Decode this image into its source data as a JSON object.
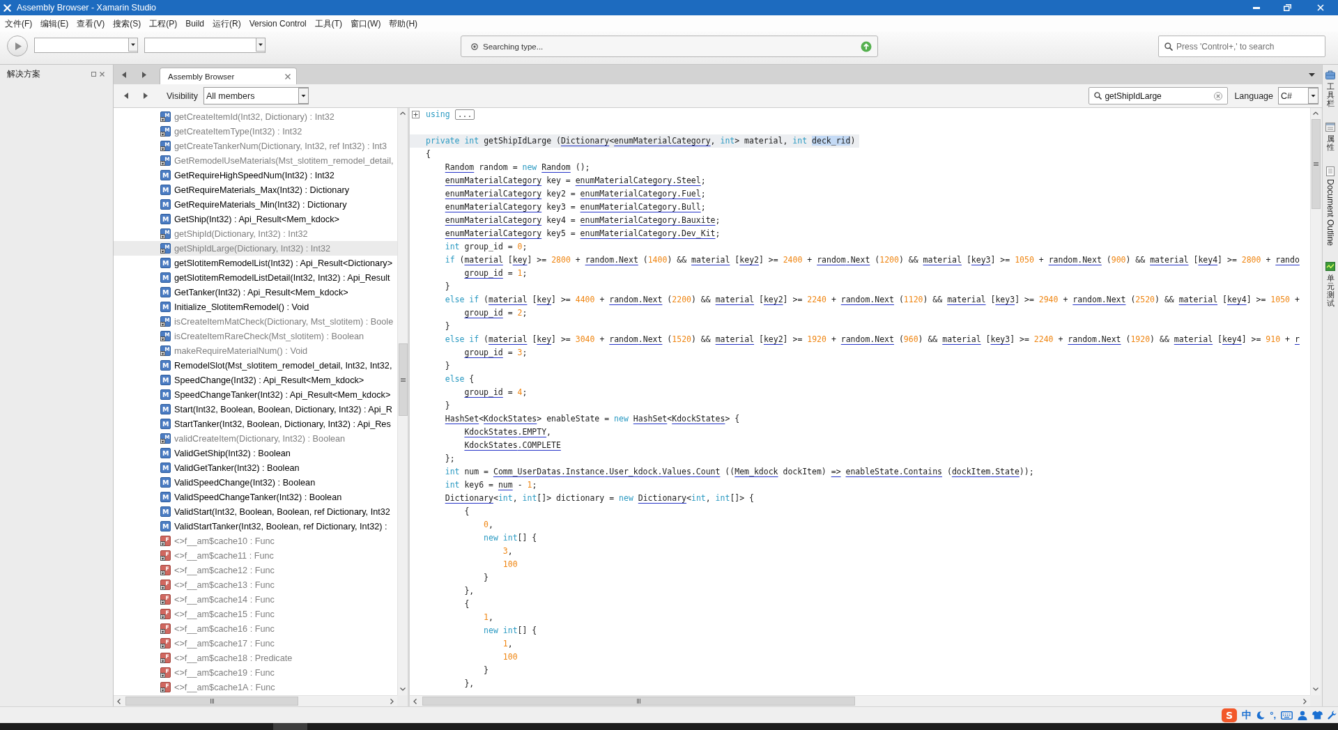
{
  "window": {
    "title": "Assembly Browser - Xamarin Studio"
  },
  "menu": [
    "文件(F)",
    "编辑(E)",
    "查看(V)",
    "搜索(S)",
    "工程(P)",
    "Build",
    "运行(R)",
    "Version Control",
    "工具(T)",
    "窗口(W)",
    "帮助(H)"
  ],
  "toolbar": {
    "status": "Searching type...",
    "search": {
      "placeholder": "Press 'Control+,' to search"
    }
  },
  "solution_pad": {
    "title": "解决方案"
  },
  "tabs": [
    {
      "label": "Assembly Browser",
      "selected": true
    }
  ],
  "browser_toolbar": {
    "visibility_label": "Visibility",
    "visibility": "All members",
    "search": {
      "value": "getShipIdLarge"
    },
    "language_label": "Language",
    "language": "C#"
  },
  "members": [
    {
      "badge": "M",
      "kind": "method",
      "label": "getCreateItemId(Int32, Dictionary) : Int32",
      "private": true,
      "selected": false
    },
    {
      "badge": "M",
      "kind": "method",
      "label": "getCreateItemType(Int32) : Int32",
      "private": true,
      "selected": false
    },
    {
      "badge": "M",
      "kind": "method",
      "label": "getCreateTankerNum(Dictionary, Int32, ref Int32) : Int3",
      "private": true,
      "selected": false
    },
    {
      "badge": "M",
      "kind": "method",
      "label": "GetRemodelUseMaterials(Mst_slotitem_remodel_detail,",
      "private": true,
      "selected": false
    },
    {
      "badge": "M",
      "kind": "method",
      "label": "GetRequireHighSpeedNum(Int32) : Int32",
      "private": false,
      "selected": false
    },
    {
      "badge": "M",
      "kind": "method",
      "label": "GetRequireMaterials_Max(Int32) : Dictionary",
      "private": false,
      "selected": false
    },
    {
      "badge": "M",
      "kind": "method",
      "label": "GetRequireMaterials_Min(Int32) : Dictionary",
      "private": false,
      "selected": false
    },
    {
      "badge": "M",
      "kind": "method",
      "label": "GetShip(Int32) : Api_Result<Mem_kdock>",
      "private": false,
      "selected": false
    },
    {
      "badge": "M",
      "kind": "method",
      "label": "getShipId(Dictionary, Int32) : Int32",
      "private": true,
      "selected": false
    },
    {
      "badge": "M",
      "kind": "method",
      "label": "getShipIdLarge(Dictionary, Int32) : Int32",
      "private": true,
      "selected": true
    },
    {
      "badge": "M",
      "kind": "method",
      "label": "getSlotitemRemodelList(Int32) : Api_Result<Dictionary>",
      "private": false,
      "selected": false
    },
    {
      "badge": "M",
      "kind": "method",
      "label": "getSlotitemRemodelListDetail(Int32, Int32) : Api_Result",
      "private": false,
      "selected": false
    },
    {
      "badge": "M",
      "kind": "method",
      "label": "GetTanker(Int32) : Api_Result<Mem_kdock>",
      "private": false,
      "selected": false
    },
    {
      "badge": "M",
      "kind": "method",
      "label": "Initialize_SlotitemRemodel() : Void",
      "private": false,
      "selected": false
    },
    {
      "badge": "M",
      "kind": "method",
      "label": "isCreateItemMatCheck(Dictionary, Mst_slotitem) : Boole",
      "private": true,
      "selected": false
    },
    {
      "badge": "M",
      "kind": "method",
      "label": "isCreateItemRareCheck(Mst_slotitem) : Boolean",
      "private": true,
      "selected": false
    },
    {
      "badge": "M",
      "kind": "method",
      "label": "makeRequireMaterialNum() : Void",
      "private": true,
      "selected": false
    },
    {
      "badge": "M",
      "kind": "method",
      "label": "RemodelSlot(Mst_slotitem_remodel_detail, Int32, Int32,",
      "private": false,
      "selected": false
    },
    {
      "badge": "M",
      "kind": "method",
      "label": "SpeedChange(Int32) : Api_Result<Mem_kdock>",
      "private": false,
      "selected": false
    },
    {
      "badge": "M",
      "kind": "method",
      "label": "SpeedChangeTanker(Int32) : Api_Result<Mem_kdock>",
      "private": false,
      "selected": false
    },
    {
      "badge": "M",
      "kind": "method",
      "label": "Start(Int32, Boolean, Boolean, Dictionary, Int32) : Api_R",
      "private": false,
      "selected": false
    },
    {
      "badge": "M",
      "kind": "method",
      "label": "StartTanker(Int32, Boolean, Dictionary, Int32) : Api_Res",
      "private": false,
      "selected": false
    },
    {
      "badge": "M",
      "kind": "method",
      "label": "validCreateItem(Dictionary, Int32) : Boolean",
      "private": true,
      "selected": false
    },
    {
      "badge": "M",
      "kind": "method",
      "label": "ValidGetShip(Int32) : Boolean",
      "private": false,
      "selected": false
    },
    {
      "badge": "M",
      "kind": "method",
      "label": "ValidGetTanker(Int32) : Boolean",
      "private": false,
      "selected": false
    },
    {
      "badge": "M",
      "kind": "method",
      "label": "ValidSpeedChange(Int32) : Boolean",
      "private": false,
      "selected": false
    },
    {
      "badge": "M",
      "kind": "method",
      "label": "ValidSpeedChangeTanker(Int32) : Boolean",
      "private": false,
      "selected": false
    },
    {
      "badge": "M",
      "kind": "method",
      "label": "ValidStart(Int32, Boolean, Boolean, ref Dictionary, Int32",
      "private": false,
      "selected": false
    },
    {
      "badge": "M",
      "kind": "method",
      "label": "ValidStartTanker(Int32, Boolean, ref Dictionary, Int32) :",
      "private": false,
      "selected": false
    },
    {
      "badge": "F",
      "kind": "field",
      "label": "<>f__am$cache10 : Func",
      "private": true,
      "selected": false
    },
    {
      "badge": "F",
      "kind": "field",
      "label": "<>f__am$cache11 : Func",
      "private": true,
      "selected": false
    },
    {
      "badge": "F",
      "kind": "field",
      "label": "<>f__am$cache12 : Func",
      "private": true,
      "selected": false
    },
    {
      "badge": "F",
      "kind": "field",
      "label": "<>f__am$cache13 : Func",
      "private": true,
      "selected": false
    },
    {
      "badge": "F",
      "kind": "field",
      "label": "<>f__am$cache14 : Func",
      "private": true,
      "selected": false
    },
    {
      "badge": "F",
      "kind": "field",
      "label": "<>f__am$cache15 : Func",
      "private": true,
      "selected": false
    },
    {
      "badge": "F",
      "kind": "field",
      "label": "<>f__am$cache16 : Func",
      "private": true,
      "selected": false
    },
    {
      "badge": "F",
      "kind": "field",
      "label": "<>f__am$cache17 : Func",
      "private": true,
      "selected": false
    },
    {
      "badge": "F",
      "kind": "field",
      "label": "<>f__am$cache18 : Predicate",
      "private": true,
      "selected": false
    },
    {
      "badge": "F",
      "kind": "field",
      "label": "<>f__am$cache19 : Func",
      "private": true,
      "selected": false
    },
    {
      "badge": "F",
      "kind": "field",
      "label": "<>f__am$cache1A : Func",
      "private": true,
      "selected": false
    }
  ],
  "code": {
    "using": {
      "keyword": "using",
      "label": "...",
      "expanded": false
    },
    "signature": [
      {
        "text": "private ",
        "kind": "keyword"
      },
      {
        "text": "int",
        "kind": "keyword"
      },
      {
        "text": " getShipIdLarge (",
        "kind": "plain"
      },
      {
        "text": "Dictionary",
        "kind": "reference"
      },
      {
        "text": "<",
        "kind": "plain"
      },
      {
        "text": "enumMaterialCategory",
        "kind": "reference"
      },
      {
        "text": ", ",
        "kind": "plain"
      },
      {
        "text": "int",
        "kind": "keyword"
      },
      {
        "text": "> material, ",
        "kind": "plain"
      },
      {
        "text": "int ",
        "kind": "keyword"
      },
      {
        "text": "deck_rid",
        "kind": "selection"
      },
      {
        "text": ")",
        "kind": "plain"
      }
    ],
    "lines": [
      {
        "tokens": [
          {
            "text": "{",
            "kind": "plain"
          }
        ]
      },
      {
        "tokens": [
          {
            "text": "    Random",
            "kind": "reference"
          },
          {
            "text": " random = ",
            "kind": "plain"
          },
          {
            "text": "new ",
            "kind": "keyword"
          },
          {
            "text": "Random",
            "kind": "reference"
          },
          {
            "text": " ();",
            "kind": "plain"
          }
        ]
      },
      {
        "tokens": [
          {
            "text": "    enumMaterialCategory",
            "kind": "reference"
          },
          {
            "text": " key = ",
            "kind": "plain"
          },
          {
            "text": "enumMaterialCategory",
            "kind": "reference"
          },
          {
            "text": ".Steel",
            "kind": "reference"
          },
          {
            "text": ";",
            "kind": "plain"
          }
        ]
      },
      {
        "tokens": [
          {
            "text": "    enumMaterialCategory",
            "kind": "reference"
          },
          {
            "text": " key2 = ",
            "kind": "plain"
          },
          {
            "text": "enumMaterialCategory",
            "kind": "reference"
          },
          {
            "text": ".Fuel",
            "kind": "reference"
          },
          {
            "text": ";",
            "kind": "plain"
          }
        ]
      },
      {
        "tokens": [
          {
            "text": "    enumMaterialCategory",
            "kind": "reference"
          },
          {
            "text": " key3 = ",
            "kind": "plain"
          },
          {
            "text": "enumMaterialCategory",
            "kind": "reference"
          },
          {
            "text": ".Bull",
            "kind": "reference"
          },
          {
            "text": ";",
            "kind": "plain"
          }
        ]
      },
      {
        "tokens": [
          {
            "text": "    enumMaterialCategory",
            "kind": "reference"
          },
          {
            "text": " key4 = ",
            "kind": "plain"
          },
          {
            "text": "enumMaterialCategory",
            "kind": "reference"
          },
          {
            "text": ".Bauxite",
            "kind": "reference"
          },
          {
            "text": ";",
            "kind": "plain"
          }
        ]
      },
      {
        "tokens": [
          {
            "text": "    enumMaterialCategory",
            "kind": "reference"
          },
          {
            "text": " key5 = ",
            "kind": "plain"
          },
          {
            "text": "enumMaterialCategory",
            "kind": "reference"
          },
          {
            "text": ".Dev_Kit",
            "kind": "reference"
          },
          {
            "text": ";",
            "kind": "plain"
          }
        ]
      },
      {
        "tokens": [
          {
            "text": "    int",
            "kind": "keyword"
          },
          {
            "text": " group_id = ",
            "kind": "plain"
          },
          {
            "text": "0",
            "kind": "number"
          },
          {
            "text": ";",
            "kind": "plain"
          }
        ]
      },
      {
        "tokens": [
          {
            "text": "    if",
            "kind": "keyword"
          },
          {
            "text": " (",
            "kind": "plain"
          },
          {
            "text": "material",
            "kind": "reference"
          },
          {
            "text": " [",
            "kind": "plain"
          },
          {
            "text": "key",
            "kind": "reference"
          },
          {
            "text": "] >= ",
            "kind": "plain"
          },
          {
            "text": "2800",
            "kind": "number"
          },
          {
            "text": " + ",
            "kind": "plain"
          },
          {
            "text": "random",
            "kind": "reference"
          },
          {
            "text": ".Next",
            "kind": "reference"
          },
          {
            "text": " (",
            "kind": "plain"
          },
          {
            "text": "1400",
            "kind": "number"
          },
          {
            "text": ") && ",
            "kind": "plain"
          },
          {
            "text": "material",
            "kind": "reference"
          },
          {
            "text": " [",
            "kind": "plain"
          },
          {
            "text": "key2",
            "kind": "reference"
          },
          {
            "text": "] >= ",
            "kind": "plain"
          },
          {
            "text": "2400",
            "kind": "number"
          },
          {
            "text": " + ",
            "kind": "plain"
          },
          {
            "text": "random",
            "kind": "reference"
          },
          {
            "text": ".Next",
            "kind": "reference"
          },
          {
            "text": " (",
            "kind": "plain"
          },
          {
            "text": "1200",
            "kind": "number"
          },
          {
            "text": ") && ",
            "kind": "plain"
          },
          {
            "text": "material",
            "kind": "reference"
          },
          {
            "text": " [",
            "kind": "plain"
          },
          {
            "text": "key3",
            "kind": "reference"
          },
          {
            "text": "] >= ",
            "kind": "plain"
          },
          {
            "text": "1050",
            "kind": "number"
          },
          {
            "text": " + ",
            "kind": "plain"
          },
          {
            "text": "random",
            "kind": "reference"
          },
          {
            "text": ".Next",
            "kind": "reference"
          },
          {
            "text": " (",
            "kind": "plain"
          },
          {
            "text": "900",
            "kind": "number"
          },
          {
            "text": ") && ",
            "kind": "plain"
          },
          {
            "text": "material",
            "kind": "reference"
          },
          {
            "text": " [",
            "kind": "plain"
          },
          {
            "text": "key4",
            "kind": "reference"
          },
          {
            "text": "] >= ",
            "kind": "plain"
          },
          {
            "text": "2800",
            "kind": "number"
          },
          {
            "text": " + ",
            "kind": "plain"
          },
          {
            "text": "rando",
            "kind": "reference"
          }
        ]
      },
      {
        "tokens": [
          {
            "text": "        group_id",
            "kind": "reference"
          },
          {
            "text": " = ",
            "kind": "plain"
          },
          {
            "text": "1",
            "kind": "number"
          },
          {
            "text": ";",
            "kind": "plain"
          }
        ]
      },
      {
        "tokens": [
          {
            "text": "    }",
            "kind": "plain"
          }
        ]
      },
      {
        "tokens": [
          {
            "text": "    else if",
            "kind": "keyword"
          },
          {
            "text": " (",
            "kind": "plain"
          },
          {
            "text": "material",
            "kind": "reference"
          },
          {
            "text": " [",
            "kind": "plain"
          },
          {
            "text": "key",
            "kind": "reference"
          },
          {
            "text": "] >= ",
            "kind": "plain"
          },
          {
            "text": "4400",
            "kind": "number"
          },
          {
            "text": " + ",
            "kind": "plain"
          },
          {
            "text": "random",
            "kind": "reference"
          },
          {
            "text": ".Next",
            "kind": "reference"
          },
          {
            "text": " (",
            "kind": "plain"
          },
          {
            "text": "2200",
            "kind": "number"
          },
          {
            "text": ") && ",
            "kind": "plain"
          },
          {
            "text": "material",
            "kind": "reference"
          },
          {
            "text": " [",
            "kind": "plain"
          },
          {
            "text": "key2",
            "kind": "reference"
          },
          {
            "text": "] >= ",
            "kind": "plain"
          },
          {
            "text": "2240",
            "kind": "number"
          },
          {
            "text": " + ",
            "kind": "plain"
          },
          {
            "text": "random",
            "kind": "reference"
          },
          {
            "text": ".Next",
            "kind": "reference"
          },
          {
            "text": " (",
            "kind": "plain"
          },
          {
            "text": "1120",
            "kind": "number"
          },
          {
            "text": ") && ",
            "kind": "plain"
          },
          {
            "text": "material",
            "kind": "reference"
          },
          {
            "text": " [",
            "kind": "plain"
          },
          {
            "text": "key3",
            "kind": "reference"
          },
          {
            "text": "] >= ",
            "kind": "plain"
          },
          {
            "text": "2940",
            "kind": "number"
          },
          {
            "text": " + ",
            "kind": "plain"
          },
          {
            "text": "random",
            "kind": "reference"
          },
          {
            "text": ".Next",
            "kind": "reference"
          },
          {
            "text": " (",
            "kind": "plain"
          },
          {
            "text": "2520",
            "kind": "number"
          },
          {
            "text": ") && ",
            "kind": "plain"
          },
          {
            "text": "material",
            "kind": "reference"
          },
          {
            "text": " [",
            "kind": "plain"
          },
          {
            "text": "key4",
            "kind": "reference"
          },
          {
            "text": "] >= ",
            "kind": "plain"
          },
          {
            "text": "1050",
            "kind": "number"
          },
          {
            "text": " +",
            "kind": "plain"
          }
        ]
      },
      {
        "tokens": [
          {
            "text": "        group_id",
            "kind": "reference"
          },
          {
            "text": " = ",
            "kind": "plain"
          },
          {
            "text": "2",
            "kind": "number"
          },
          {
            "text": ";",
            "kind": "plain"
          }
        ]
      },
      {
        "tokens": [
          {
            "text": "    }",
            "kind": "plain"
          }
        ]
      },
      {
        "tokens": [
          {
            "text": "    else if",
            "kind": "keyword"
          },
          {
            "text": " (",
            "kind": "plain"
          },
          {
            "text": "material",
            "kind": "reference"
          },
          {
            "text": " [",
            "kind": "plain"
          },
          {
            "text": "key",
            "kind": "reference"
          },
          {
            "text": "] >= ",
            "kind": "plain"
          },
          {
            "text": "3040",
            "kind": "number"
          },
          {
            "text": " + ",
            "kind": "plain"
          },
          {
            "text": "random",
            "kind": "reference"
          },
          {
            "text": ".Next",
            "kind": "reference"
          },
          {
            "text": " (",
            "kind": "plain"
          },
          {
            "text": "1520",
            "kind": "number"
          },
          {
            "text": ") && ",
            "kind": "plain"
          },
          {
            "text": "material",
            "kind": "reference"
          },
          {
            "text": " [",
            "kind": "plain"
          },
          {
            "text": "key2",
            "kind": "reference"
          },
          {
            "text": "] >= ",
            "kind": "plain"
          },
          {
            "text": "1920",
            "kind": "number"
          },
          {
            "text": " + ",
            "kind": "plain"
          },
          {
            "text": "random",
            "kind": "reference"
          },
          {
            "text": ".Next",
            "kind": "reference"
          },
          {
            "text": " (",
            "kind": "plain"
          },
          {
            "text": "960",
            "kind": "number"
          },
          {
            "text": ") && ",
            "kind": "plain"
          },
          {
            "text": "material",
            "kind": "reference"
          },
          {
            "text": " [",
            "kind": "plain"
          },
          {
            "text": "key3",
            "kind": "reference"
          },
          {
            "text": "] >= ",
            "kind": "plain"
          },
          {
            "text": "2240",
            "kind": "number"
          },
          {
            "text": " + ",
            "kind": "plain"
          },
          {
            "text": "random",
            "kind": "reference"
          },
          {
            "text": ".Next",
            "kind": "reference"
          },
          {
            "text": " (",
            "kind": "plain"
          },
          {
            "text": "1920",
            "kind": "number"
          },
          {
            "text": ") && ",
            "kind": "plain"
          },
          {
            "text": "material",
            "kind": "reference"
          },
          {
            "text": " [",
            "kind": "plain"
          },
          {
            "text": "key4",
            "kind": "reference"
          },
          {
            "text": "] >= ",
            "kind": "plain"
          },
          {
            "text": "910",
            "kind": "number"
          },
          {
            "text": " + ",
            "kind": "plain"
          },
          {
            "text": "r",
            "kind": "reference"
          }
        ]
      },
      {
        "tokens": [
          {
            "text": "        group_id",
            "kind": "reference"
          },
          {
            "text": " = ",
            "kind": "plain"
          },
          {
            "text": "3",
            "kind": "number"
          },
          {
            "text": ";",
            "kind": "plain"
          }
        ]
      },
      {
        "tokens": [
          {
            "text": "    }",
            "kind": "plain"
          }
        ]
      },
      {
        "tokens": [
          {
            "text": "    else",
            "kind": "keyword"
          },
          {
            "text": " {",
            "kind": "plain"
          }
        ]
      },
      {
        "tokens": [
          {
            "text": "        group_id",
            "kind": "reference"
          },
          {
            "text": " = ",
            "kind": "plain"
          },
          {
            "text": "4",
            "kind": "number"
          },
          {
            "text": ";",
            "kind": "plain"
          }
        ]
      },
      {
        "tokens": [
          {
            "text": "    }",
            "kind": "plain"
          }
        ]
      },
      {
        "tokens": [
          {
            "text": "    HashSet",
            "kind": "reference"
          },
          {
            "text": "<",
            "kind": "plain"
          },
          {
            "text": "KdockStates",
            "kind": "reference"
          },
          {
            "text": "> enableState = ",
            "kind": "plain"
          },
          {
            "text": "new ",
            "kind": "keyword"
          },
          {
            "text": "HashSet",
            "kind": "reference"
          },
          {
            "text": "<",
            "kind": "plain"
          },
          {
            "text": "KdockStates",
            "kind": "reference"
          },
          {
            "text": "> {",
            "kind": "plain"
          }
        ]
      },
      {
        "tokens": [
          {
            "text": "        KdockStates",
            "kind": "reference"
          },
          {
            "text": ".EMPTY",
            "kind": "reference"
          },
          {
            "text": ",",
            "kind": "plain"
          }
        ]
      },
      {
        "tokens": [
          {
            "text": "        KdockStates",
            "kind": "reference"
          },
          {
            "text": ".COMPLETE",
            "kind": "reference"
          }
        ]
      },
      {
        "tokens": [
          {
            "text": "    };",
            "kind": "plain"
          }
        ]
      },
      {
        "tokens": [
          {
            "text": "    int",
            "kind": "keyword"
          },
          {
            "text": " num = ",
            "kind": "plain"
          },
          {
            "text": "Comm_UserDatas",
            "kind": "reference"
          },
          {
            "text": ".Instance",
            "kind": "reference"
          },
          {
            "text": ".User_kdock",
            "kind": "reference"
          },
          {
            "text": ".Values",
            "kind": "reference"
          },
          {
            "text": ".Count",
            "kind": "reference"
          },
          {
            "text": " ((",
            "kind": "plain"
          },
          {
            "text": "Mem_kdock",
            "kind": "reference"
          },
          {
            "text": " dockItem) ",
            "kind": "plain"
          },
          {
            "text": "=> ",
            "kind": "reference"
          },
          {
            "text": "enableState",
            "kind": "reference"
          },
          {
            "text": ".Contains",
            "kind": "reference"
          },
          {
            "text": " (",
            "kind": "plain"
          },
          {
            "text": "dockItem",
            "kind": "reference"
          },
          {
            "text": ".State",
            "kind": "reference"
          },
          {
            "text": "));",
            "kind": "plain"
          }
        ]
      },
      {
        "tokens": [
          {
            "text": "    int",
            "kind": "keyword"
          },
          {
            "text": " key6 = ",
            "kind": "plain"
          },
          {
            "text": "num",
            "kind": "reference"
          },
          {
            "text": " - ",
            "kind": "plain"
          },
          {
            "text": "1",
            "kind": "number"
          },
          {
            "text": ";",
            "kind": "plain"
          }
        ]
      },
      {
        "tokens": [
          {
            "text": "    Dictionary",
            "kind": "reference"
          },
          {
            "text": "<",
            "kind": "plain"
          },
          {
            "text": "int",
            "kind": "keyword"
          },
          {
            "text": ", ",
            "kind": "plain"
          },
          {
            "text": "int",
            "kind": "keyword"
          },
          {
            "text": "[]> dictionary = ",
            "kind": "plain"
          },
          {
            "text": "new ",
            "kind": "keyword"
          },
          {
            "text": "Dictionary",
            "kind": "reference"
          },
          {
            "text": "<",
            "kind": "plain"
          },
          {
            "text": "int",
            "kind": "keyword"
          },
          {
            "text": ", ",
            "kind": "plain"
          },
          {
            "text": "int",
            "kind": "keyword"
          },
          {
            "text": "[]> {",
            "kind": "plain"
          }
        ]
      },
      {
        "tokens": [
          {
            "text": "        {",
            "kind": "plain"
          }
        ]
      },
      {
        "tokens": [
          {
            "text": "            0",
            "kind": "number"
          },
          {
            "text": ",",
            "kind": "plain"
          }
        ]
      },
      {
        "tokens": [
          {
            "text": "            new int",
            "kind": "keyword"
          },
          {
            "text": "[] {",
            "kind": "plain"
          }
        ]
      },
      {
        "tokens": [
          {
            "text": "                3",
            "kind": "number"
          },
          {
            "text": ",",
            "kind": "plain"
          }
        ]
      },
      {
        "tokens": [
          {
            "text": "                100",
            "kind": "number"
          }
        ]
      },
      {
        "tokens": [
          {
            "text": "            }",
            "kind": "plain"
          }
        ]
      },
      {
        "tokens": [
          {
            "text": "        },",
            "kind": "plain"
          }
        ]
      },
      {
        "tokens": [
          {
            "text": "        {",
            "kind": "plain"
          }
        ]
      },
      {
        "tokens": [
          {
            "text": "            1",
            "kind": "number"
          },
          {
            "text": ",",
            "kind": "plain"
          }
        ]
      },
      {
        "tokens": [
          {
            "text": "            new int",
            "kind": "keyword"
          },
          {
            "text": "[] {",
            "kind": "plain"
          }
        ]
      },
      {
        "tokens": [
          {
            "text": "                1",
            "kind": "number"
          },
          {
            "text": ",",
            "kind": "plain"
          }
        ]
      },
      {
        "tokens": [
          {
            "text": "                100",
            "kind": "number"
          }
        ]
      },
      {
        "tokens": [
          {
            "text": "            }",
            "kind": "plain"
          }
        ]
      },
      {
        "tokens": [
          {
            "text": "        },",
            "kind": "plain"
          }
        ]
      }
    ]
  },
  "side_tabs": [
    {
      "label": "工具栏",
      "kind": "stacked"
    },
    {
      "label": "属性",
      "kind": "stacked"
    },
    {
      "label": "Document Outline",
      "kind": "rotated"
    },
    {
      "label": "单元测试",
      "kind": "stacked"
    }
  ],
  "ime": {
    "logo": "S",
    "mode": "中",
    "punctuation": "°,"
  }
}
